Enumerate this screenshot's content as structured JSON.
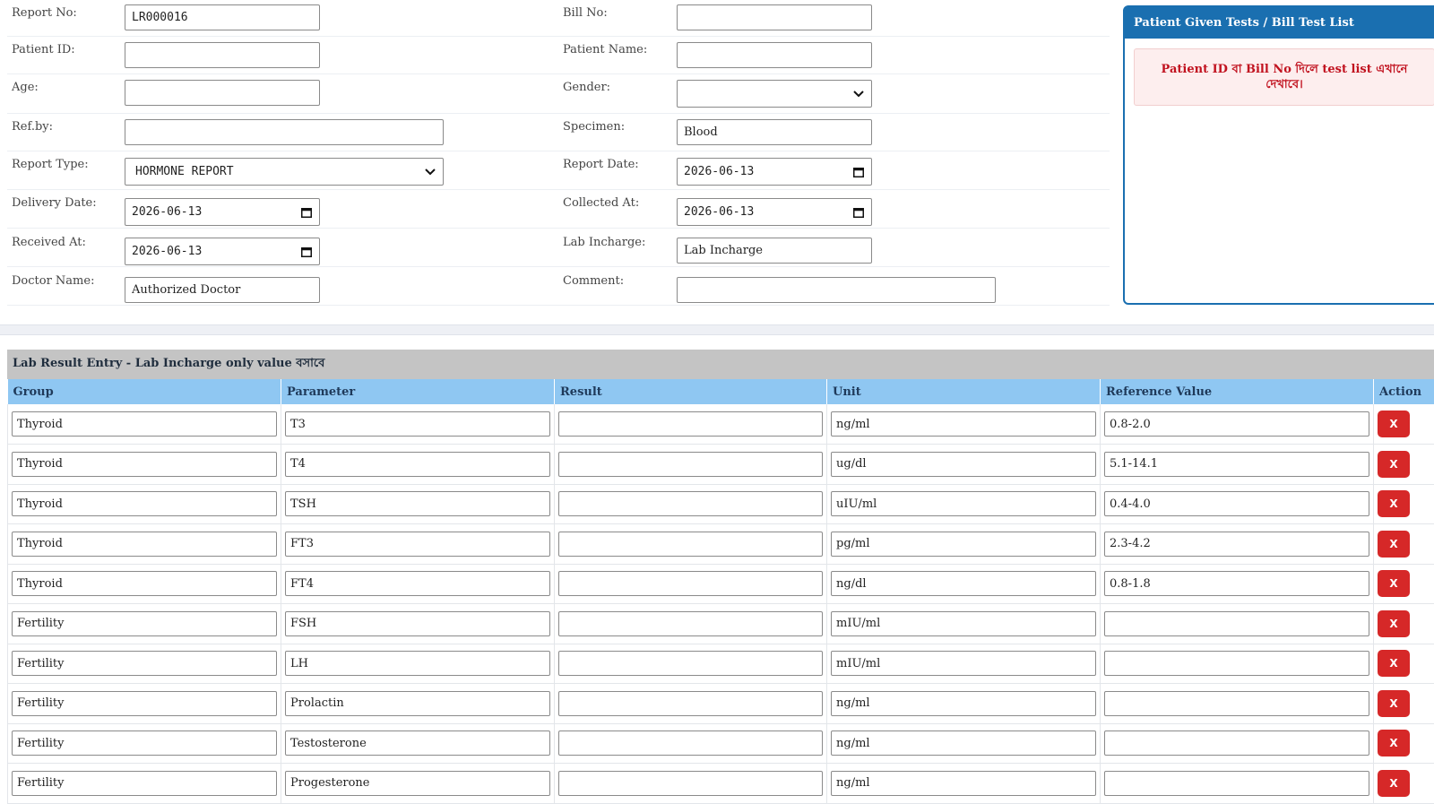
{
  "form": {
    "report_no": {
      "label": "Report No:",
      "value": "LR000016"
    },
    "bill_no": {
      "label": "Bill No:",
      "value": ""
    },
    "patient_id": {
      "label": "Patient ID:",
      "value": ""
    },
    "patient_name": {
      "label": "Patient Name:",
      "value": ""
    },
    "age": {
      "label": "Age:",
      "value": ""
    },
    "gender": {
      "label": "Gender:",
      "value": ""
    },
    "ref_by": {
      "label": "Ref.by:",
      "value": ""
    },
    "specimen": {
      "label": "Specimen:",
      "value": "Blood"
    },
    "report_type": {
      "label": "Report Type:",
      "value": "HORMONE REPORT"
    },
    "report_date": {
      "label": "Report Date:",
      "value": "2026-06-13"
    },
    "delivery_date": {
      "label": "Delivery Date:",
      "value": "2026-06-13"
    },
    "collected_at": {
      "label": "Collected At:",
      "value": "2026-06-13"
    },
    "received_at": {
      "label": "Received At:",
      "value": "2026-06-13"
    },
    "lab_incharge": {
      "label": "Lab Incharge:",
      "value": "Lab Incharge"
    },
    "doctor_name": {
      "label": "Doctor Name:",
      "value": "Authorized Doctor"
    },
    "comment": {
      "label": "Comment:",
      "value": ""
    }
  },
  "side_panel": {
    "title": "Patient Given Tests / Bill Test List",
    "message": "Patient ID বা Bill No দিলে test list এখানে দেখাবে।"
  },
  "lab": {
    "title": "Lab Result Entry - Lab Incharge only value বসাবে",
    "columns": [
      "Group",
      "Parameter",
      "Result",
      "Unit",
      "Reference Value",
      "Action"
    ],
    "delete_label": "X",
    "rows": [
      {
        "group": "Thyroid",
        "parameter": "T3",
        "result": "",
        "unit": "ng/ml",
        "reference": "0.8-2.0"
      },
      {
        "group": "Thyroid",
        "parameter": "T4",
        "result": "",
        "unit": "ug/dl",
        "reference": "5.1-14.1"
      },
      {
        "group": "Thyroid",
        "parameter": "TSH",
        "result": "",
        "unit": "uIU/ml",
        "reference": "0.4-4.0"
      },
      {
        "group": "Thyroid",
        "parameter": "FT3",
        "result": "",
        "unit": "pg/ml",
        "reference": "2.3-4.2"
      },
      {
        "group": "Thyroid",
        "parameter": "FT4",
        "result": "",
        "unit": "ng/dl",
        "reference": "0.8-1.8"
      },
      {
        "group": "Fertility",
        "parameter": "FSH",
        "result": "",
        "unit": "mIU/ml",
        "reference": ""
      },
      {
        "group": "Fertility",
        "parameter": "LH",
        "result": "",
        "unit": "mIU/ml",
        "reference": ""
      },
      {
        "group": "Fertility",
        "parameter": "Prolactin",
        "result": "",
        "unit": "ng/ml",
        "reference": ""
      },
      {
        "group": "Fertility",
        "parameter": "Testosterone",
        "result": "",
        "unit": "ng/ml",
        "reference": ""
      },
      {
        "group": "Fertility",
        "parameter": "Progesterone",
        "result": "",
        "unit": "ng/ml",
        "reference": ""
      }
    ]
  },
  "colors": {
    "panel_blue": "#1a6fb0",
    "header_light_blue": "#8fc7f2",
    "delete_red": "#d62828",
    "alert_text": "#c1121f"
  }
}
